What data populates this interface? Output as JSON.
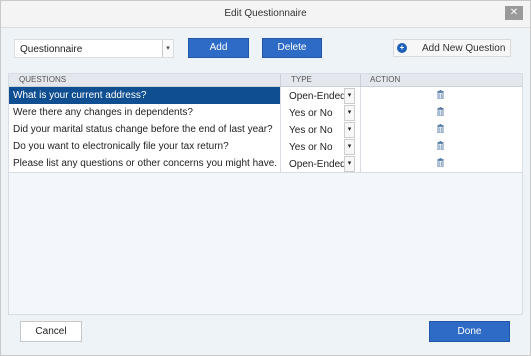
{
  "window": {
    "title": "Edit Questionnaire",
    "close_glyph": "✕"
  },
  "toolbar": {
    "questionnaire_select": "Questionnaire",
    "add_label": "Add",
    "delete_label": "Delete",
    "add_new_question_label": "Add New Question"
  },
  "table": {
    "headers": {
      "questions": "QUESTIONS",
      "type": "TYPE",
      "action": "ACTION"
    },
    "rows": [
      {
        "question": "What is your current address?",
        "type": "Open-Ended",
        "selected": true
      },
      {
        "question": "Were there any changes in dependents?",
        "type": "Yes or No",
        "selected": false
      },
      {
        "question": "Did your marital status change before the end of last year?",
        "type": "Yes or No",
        "selected": false
      },
      {
        "question": "Do you want to electronically file your tax return?",
        "type": "Yes or No",
        "selected": false
      },
      {
        "question": "Please list any questions or other concerns you might have.",
        "type": "Open-Ended",
        "selected": false
      }
    ]
  },
  "footer": {
    "cancel_label": "Cancel",
    "done_label": "Done"
  },
  "colors": {
    "accent": "#2e6bc6",
    "selection": "#0f4e90"
  },
  "icons": [
    "close-icon",
    "plus-circle-icon",
    "trash-icon",
    "dropdown-arrow-icon"
  ]
}
